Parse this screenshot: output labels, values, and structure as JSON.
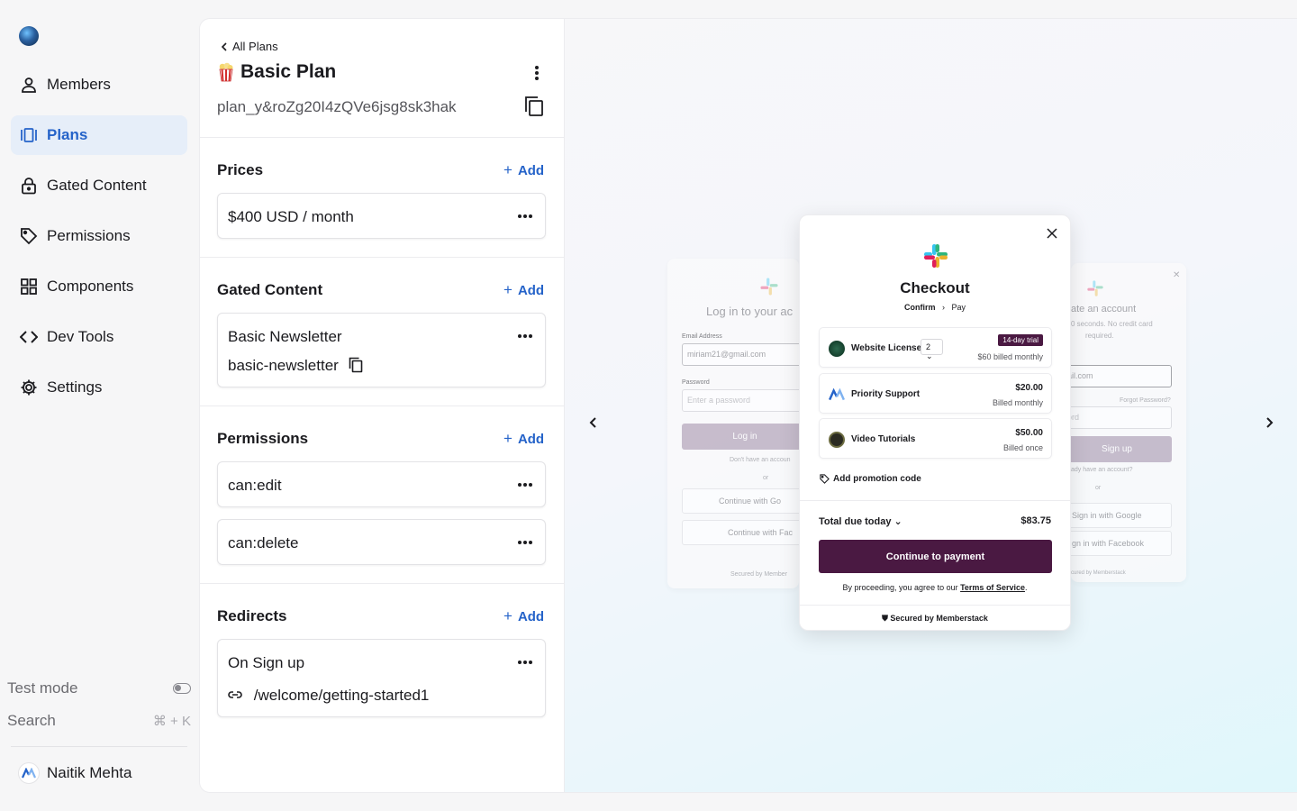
{
  "sidebar": {
    "nav": [
      {
        "label": "Members",
        "icon": "user-icon"
      },
      {
        "label": "Plans",
        "icon": "plans-icon",
        "active": true
      },
      {
        "label": "Gated Content",
        "icon": "lock-icon"
      },
      {
        "label": "Permissions",
        "icon": "tag-icon"
      },
      {
        "label": "Components",
        "icon": "grid-icon"
      },
      {
        "label": "Dev Tools",
        "icon": "code-icon"
      },
      {
        "label": "Settings",
        "icon": "gear-icon"
      }
    ],
    "test_mode_label": "Test mode",
    "search_label": "Search",
    "search_shortcut": "⌘ + K",
    "user_name": "Naitik Mehta"
  },
  "plan": {
    "back_label": "All Plans",
    "title": "Basic Plan",
    "id": "plan_y&roZg20I4zQVe6jsg8sk3hak"
  },
  "sections": {
    "add_label": "Add",
    "prices": {
      "title": "Prices",
      "items": [
        "$400 USD / month"
      ]
    },
    "gated": {
      "title": "Gated Content",
      "item_name": "Basic Newsletter",
      "item_slug": "basic-newsletter"
    },
    "permissions": {
      "title": "Permissions",
      "items": [
        "can:edit",
        "can:delete"
      ]
    },
    "redirects": {
      "title": "Redirects",
      "item_name": "On Sign up",
      "item_path": "/welcome/getting-started1"
    }
  },
  "login_ghost": {
    "title": "Log in to your ac",
    "email_label": "Email Address",
    "email_value": "miriam21@gmail.com",
    "password_label": "Password",
    "password_placeholder": "Enter a password",
    "button": "Log in",
    "no_account": "Don't have an accoun",
    "or": "or",
    "google": "Continue with Go",
    "facebook": "Continue with Fac",
    "secured": "Secured by Member"
  },
  "signup_ghost": {
    "title": "ate an account",
    "subtitle1": "0 seconds. No credit card",
    "subtitle2": "required.",
    "email_value": "ail.com",
    "forgot": "Forgot Password?",
    "password_placeholder": "ord",
    "button": "Sign up",
    "have_account": "ady have an account?",
    "or": "or",
    "google": "Sign in with Google",
    "facebook": "gn in with Facebook",
    "secured": "cured by Memberstack"
  },
  "checkout": {
    "title": "Checkout",
    "step1": "Confirm",
    "step2": "Pay",
    "items": [
      {
        "name": "Website License",
        "qty": "2",
        "badge": "14-day trial",
        "sub": "$60 billed monthly"
      },
      {
        "name": "Priority Support",
        "price": "$20.00",
        "sub": "Billed monthly"
      },
      {
        "name": "Video Tutorials",
        "price": "$50.00",
        "sub": "Billed once"
      }
    ],
    "promo": "Add promotion code",
    "total_label": "Total due today",
    "total_value": "$83.75",
    "pay_button": "Continue to payment",
    "terms_prefix": "By proceeding, you agree to our ",
    "terms_link": "Terms of Service",
    "terms_suffix": ".",
    "secured": "Secured by Memberstack"
  },
  "colors": {
    "accent": "#2563c9",
    "active_bg": "#e6eef9",
    "brand": "#4a1942"
  }
}
